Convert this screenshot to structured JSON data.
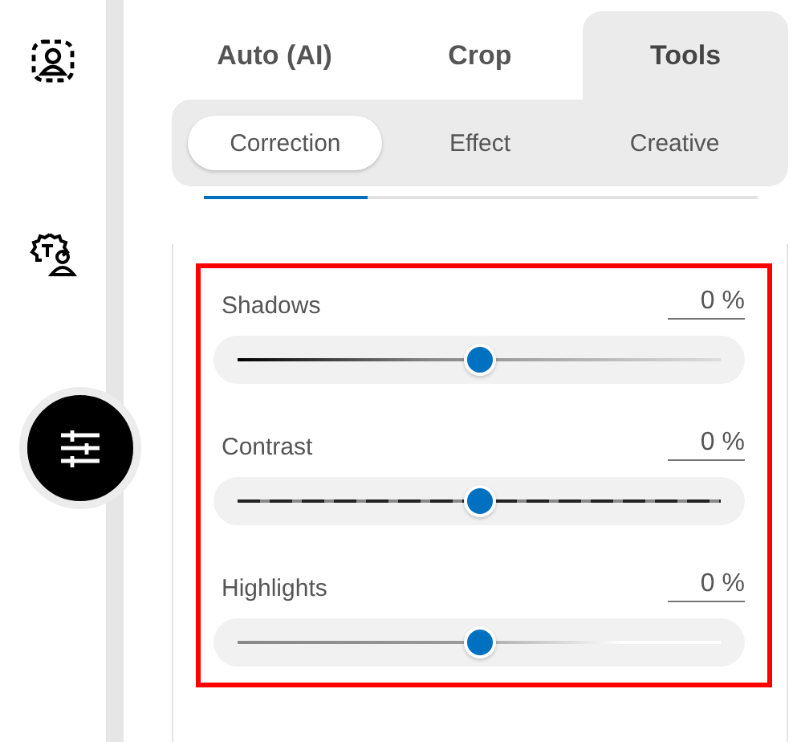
{
  "tabs": [
    {
      "label": "Auto (AI)",
      "selected": false
    },
    {
      "label": "Crop",
      "selected": false
    },
    {
      "label": "Tools",
      "selected": true
    }
  ],
  "subtabs": [
    {
      "label": "Correction",
      "selected": true
    },
    {
      "label": "Effect",
      "selected": false
    },
    {
      "label": "Creative",
      "selected": false
    }
  ],
  "adjustments": [
    {
      "name": "Shadows",
      "value": "0 %",
      "level": 0.5,
      "kind": "gradient"
    },
    {
      "name": "Contrast",
      "value": "0 %",
      "level": 0.5,
      "kind": "dashed"
    },
    {
      "name": "Highlights",
      "value": "0 %",
      "level": 0.5,
      "kind": "fade"
    }
  ]
}
